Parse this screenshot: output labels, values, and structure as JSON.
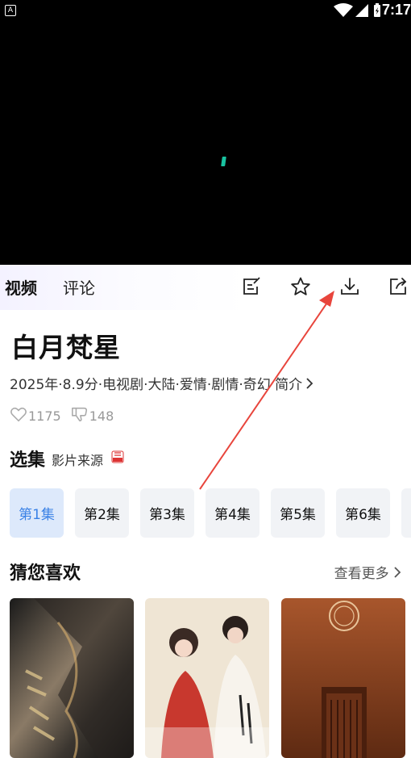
{
  "status_bar": {
    "time": "7:17",
    "app_icon_letter": "A"
  },
  "tabs": [
    {
      "label": "视频",
      "active": true
    },
    {
      "label": "评论",
      "active": false
    }
  ],
  "toolbar_icons": [
    "edit-note-icon",
    "star-icon",
    "download-icon",
    "share-icon"
  ],
  "show": {
    "title": "白月梵星",
    "meta": "2025年·8.9分·电视剧·大陆·爱情·剧情·奇幻 简介",
    "likes": "1175",
    "dislikes": "148"
  },
  "episodes_section": {
    "title": "选集",
    "source_label": "影片来源"
  },
  "episodes": [
    {
      "label": "第1集",
      "active": true
    },
    {
      "label": "第2集",
      "active": false
    },
    {
      "label": "第3集",
      "active": false
    },
    {
      "label": "第4集",
      "active": false
    },
    {
      "label": "第5集",
      "active": false
    },
    {
      "label": "第6集",
      "active": false
    }
  ],
  "recommend": {
    "title": "猜您喜欢",
    "more_label": "查看更多",
    "posters": [
      {
        "name": "poster-1"
      },
      {
        "name": "poster-2"
      },
      {
        "name": "poster-3"
      }
    ]
  },
  "colors": {
    "accent": "#3b82e6",
    "annotation_arrow": "#e8453c",
    "loading_indicator": "#19c2a0"
  }
}
